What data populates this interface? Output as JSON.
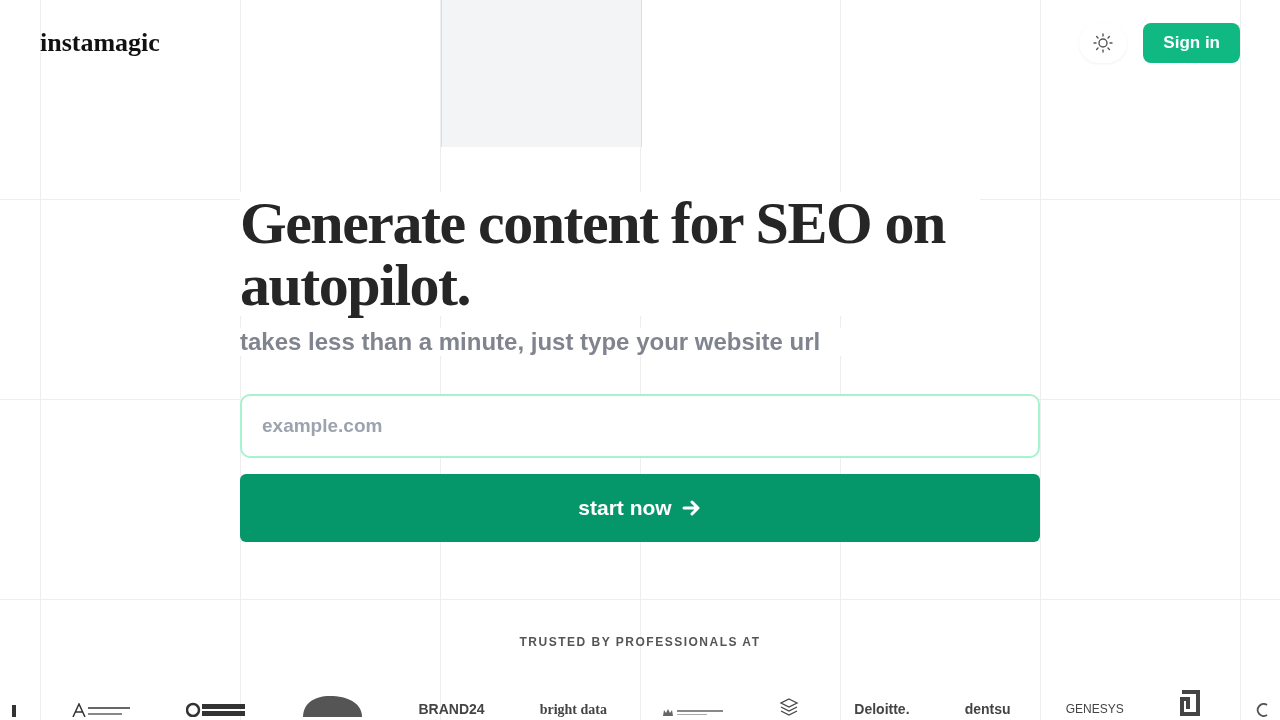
{
  "header": {
    "logo": "instamagic",
    "sign_in": "Sign in"
  },
  "hero": {
    "title": "Generate content for SEO on autopilot.",
    "subtitle": "takes less than a minute, just type your website url",
    "url_field": {
      "placeholder": "example.com"
    },
    "submit": "start now"
  },
  "trusted": {
    "label": "TRUSTED BY PROFESSIONALS AT",
    "logos": [
      {
        "kind": "bar"
      },
      {
        "kind": "arizona"
      },
      {
        "kind": "bajaj"
      },
      {
        "kind": "blob"
      },
      {
        "kind": "wordmark",
        "text": "BRAND24"
      },
      {
        "kind": "serifmark",
        "text": "bright data"
      },
      {
        "kind": "crown"
      },
      {
        "kind": "layers"
      },
      {
        "kind": "wordmark",
        "text": "Deloitte."
      },
      {
        "kind": "wordmark",
        "text": "dentsu"
      },
      {
        "kind": "thinmark",
        "text": "GENESYS"
      },
      {
        "kind": "bracket"
      },
      {
        "kind": "ring"
      }
    ]
  }
}
